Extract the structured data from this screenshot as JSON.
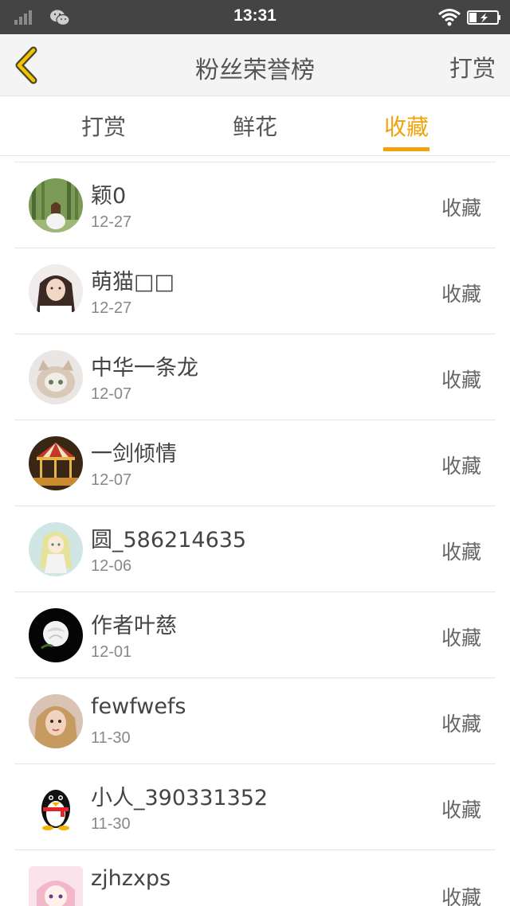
{
  "status_bar": {
    "time": "13:31"
  },
  "nav": {
    "title": "粉丝荣誉榜",
    "action": "打赏"
  },
  "tabs": [
    {
      "label": "打赏",
      "active": false
    },
    {
      "label": "鲜花",
      "active": false
    },
    {
      "label": "收藏",
      "active": true
    }
  ],
  "colors": {
    "accent": "#f0a30a",
    "status_bar": "#444444",
    "nav_bg": "#f4f4f4"
  },
  "fans": [
    {
      "name": "颖0",
      "date": "12-27",
      "action": "收藏",
      "avatar": "forest-girl-avatar"
    },
    {
      "name": "萌猫□□",
      "date": "12-27",
      "action": "收藏",
      "avatar": "girl-avatar"
    },
    {
      "name": "中华一条龙",
      "date": "12-07",
      "action": "收藏",
      "avatar": "cat-avatar"
    },
    {
      "name": "一剑倾情",
      "date": "12-07",
      "action": "收藏",
      "avatar": "carousel-avatar"
    },
    {
      "name": "圆_586214635",
      "date": "12-06",
      "action": "收藏",
      "avatar": "anime-girl-avatar"
    },
    {
      "name": "作者叶慈",
      "date": "12-01",
      "action": "收藏",
      "avatar": "white-rose-avatar"
    },
    {
      "name": "fewfwefs",
      "date": "11-30",
      "action": "收藏",
      "avatar": "blonde-girl-avatar"
    },
    {
      "name": "小人_390331352",
      "date": "11-30",
      "action": "收藏",
      "avatar": "qq-penguin-avatar"
    },
    {
      "name": "zjhzxps",
      "date": "",
      "action": "收藏",
      "avatar": "pink-anime-avatar"
    }
  ]
}
